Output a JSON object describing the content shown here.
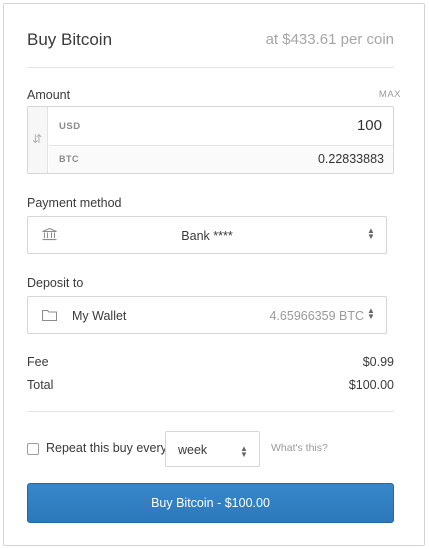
{
  "header": {
    "title": "Buy Bitcoin",
    "rate": "at $433.61 per coin"
  },
  "amount": {
    "label": "Amount",
    "max_label": "MAX",
    "usd_code": "USD",
    "usd_value": "100",
    "btc_code": "BTC",
    "btc_value": "0.22833883",
    "swap_icon": "swap-vertical-icon"
  },
  "payment": {
    "label": "Payment method",
    "icon": "bank-icon",
    "selected": "Bank ****"
  },
  "deposit": {
    "label": "Deposit to",
    "icon": "folder-icon",
    "wallet_name": "My Wallet",
    "wallet_balance": "4.65966359 BTC"
  },
  "summary": {
    "fee_label": "Fee",
    "fee_value": "$0.99",
    "total_label": "Total",
    "total_value": "$100.00"
  },
  "repeat": {
    "label": "Repeat this buy every",
    "checked": false,
    "frequency": "week",
    "help_link": "What's this?"
  },
  "submit": {
    "label": "Buy Bitcoin - $100.00"
  },
  "colors": {
    "button": "#2e7cbf",
    "muted_text": "#a6a6a6",
    "border": "#d6d6d6"
  }
}
